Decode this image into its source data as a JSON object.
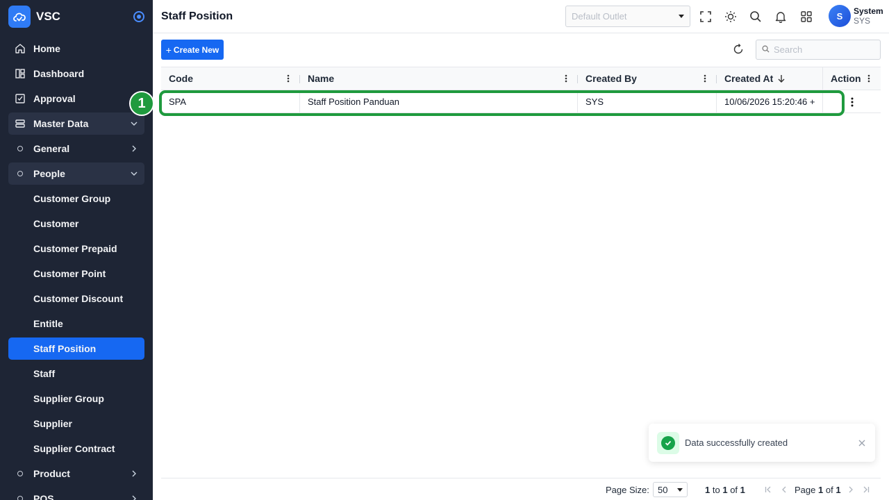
{
  "app": {
    "name": "VSC"
  },
  "sidebar": {
    "items": [
      {
        "label": "Home",
        "icon": "home-icon"
      },
      {
        "label": "Dashboard",
        "icon": "dashboard-icon"
      },
      {
        "label": "Approval",
        "icon": "approval-icon"
      },
      {
        "label": "Master Data",
        "icon": "server-icon",
        "expanded": true
      },
      {
        "label": "General",
        "icon": "circle-icon"
      },
      {
        "label": "People",
        "icon": "circle-icon",
        "expanded": true
      },
      {
        "label": "Customer Group"
      },
      {
        "label": "Customer"
      },
      {
        "label": "Customer Prepaid"
      },
      {
        "label": "Customer Point"
      },
      {
        "label": "Customer Discount"
      },
      {
        "label": "Entitle"
      },
      {
        "label": "Staff Position",
        "active": true
      },
      {
        "label": "Staff"
      },
      {
        "label": "Supplier Group"
      },
      {
        "label": "Supplier"
      },
      {
        "label": "Supplier Contract"
      },
      {
        "label": "Product",
        "icon": "circle-icon"
      },
      {
        "label": "POS",
        "icon": "circle-icon"
      }
    ]
  },
  "header": {
    "title": "Staff Position",
    "outlet_placeholder": "Default Outlet",
    "user": {
      "initial": "S",
      "name": "System",
      "code": "SYS"
    }
  },
  "toolbar": {
    "create_label": "Create New",
    "search_placeholder": "Search"
  },
  "grid": {
    "columns": [
      "Code",
      "Name",
      "Created By",
      "Created At",
      "Action"
    ],
    "rows": [
      {
        "code": "SPA",
        "name": "Staff Position Panduan",
        "created_by": "SYS",
        "created_at": "10/06/2026 15:20:46 +"
      }
    ]
  },
  "annotation": {
    "number": "1"
  },
  "toast": {
    "message": "Data successfully created"
  },
  "footer": {
    "page_size_label": "Page Size:",
    "page_size": "50",
    "range_from": "1",
    "range_to_word": "to",
    "range_to": "1",
    "range_of_word": "of",
    "range_total": "1",
    "page_word": "Page",
    "page_current": "1",
    "page_of_word": "of",
    "page_total": "1"
  },
  "colors": {
    "sidebar_bg": "#1e2535",
    "accent": "#1668f2",
    "highlight": "#1f9a3e",
    "success": "#16a34a"
  }
}
